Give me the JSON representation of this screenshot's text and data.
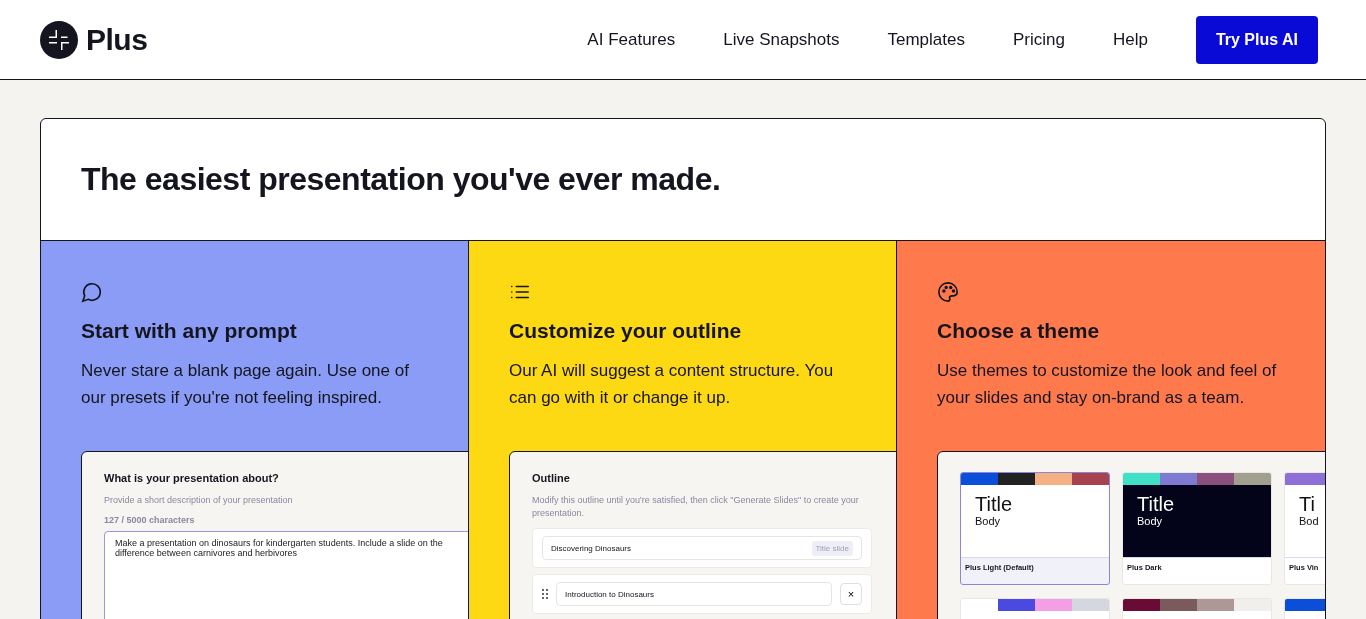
{
  "header": {
    "brand": "Plus",
    "nav": [
      {
        "label": "AI Features"
      },
      {
        "label": "Live Snapshots"
      },
      {
        "label": "Templates"
      },
      {
        "label": "Pricing"
      },
      {
        "label": "Help"
      }
    ],
    "cta": "Try Plus AI"
  },
  "hero": {
    "title": "The easiest presentation you've ever made."
  },
  "features": [
    {
      "kind": "prompt",
      "color": "#8a9cf5",
      "title": "Start with any prompt",
      "description": "Never stare a blank page again. Use one of our presets if you're not feeling inspired.",
      "preview": {
        "heading": "What is your presentation about?",
        "hint": "Provide a short description of your presentation",
        "counter": "127 / 5000 characters",
        "value": "Make a presentation on dinosaurs for kindergarten students. Include a slide on the difference between carnivores and herbivores"
      }
    },
    {
      "kind": "outline",
      "color": "#fdd913",
      "title": "Customize your outline",
      "description": "Our AI will suggest a content structure. You can go with it or change it up.",
      "preview": {
        "heading": "Outline",
        "hint": "Modify this outline until you're satisfied, then click \"Generate Slides\" to create your presentation.",
        "items": [
          {
            "text": "Discovering Dinosaurs",
            "tag": "Title slide"
          },
          {
            "text": "Introduction to Dinosaurs",
            "close": "×"
          }
        ]
      }
    },
    {
      "kind": "theme",
      "color": "#fe7a4d",
      "title": "Choose a theme",
      "description": "Use themes to customize the look and feel of your slides and stay on-brand as a team.",
      "preview": {
        "themes": [
          {
            "title": "Title",
            "body": "Body",
            "name": "Plus Light (Default)",
            "dark": false,
            "selected": true,
            "stripes": [
              {
                "color": "#0b4fd9"
              },
              {
                "color": "#222222"
              },
              {
                "color": "#f4b183"
              },
              {
                "color": "#a6434f"
              }
            ]
          },
          {
            "title": "Title",
            "body": "Body",
            "name": "Plus Dark",
            "dark": true,
            "selected": false,
            "stripes": [
              {
                "color": "#3fe0c5"
              },
              {
                "color": "#7f7ad1"
              },
              {
                "color": "#8b4f7d"
              },
              {
                "color": "#a19f8e"
              }
            ]
          },
          {
            "title": "Ti",
            "body": "Bod",
            "name": "Plus Vin",
            "dark": false,
            "selected": false,
            "stripes": [
              {
                "color": "#8e6fd8"
              }
            ]
          },
          {
            "selected": false,
            "stripes": [
              {
                "color": "#ffffff"
              },
              {
                "color": "#4a49e0"
              },
              {
                "color": "#f59ee8"
              },
              {
                "color": "#d4d6e0"
              }
            ]
          },
          {
            "selected": false,
            "stripes": [
              {
                "color": "#6a0b36"
              },
              {
                "color": "#7a5a5c"
              },
              {
                "color": "#ad9797"
              },
              {
                "color": "#f1eeee"
              }
            ]
          },
          {
            "selected": false,
            "stripes": [
              {
                "color": "#0b4fd9"
              }
            ]
          }
        ]
      }
    }
  ]
}
